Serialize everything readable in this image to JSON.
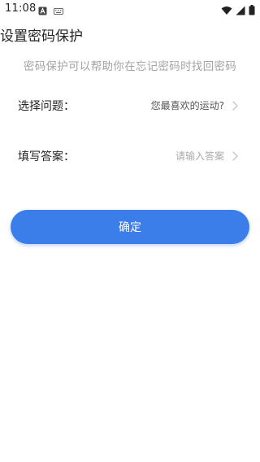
{
  "status_bar": {
    "time": "11:08"
  },
  "page": {
    "title": "设置密码保护",
    "description": "密码保护可以帮助你在忘记密码时找回密码"
  },
  "question_row": {
    "label": "选择问题：",
    "value": "您最喜欢的运动?"
  },
  "answer_row": {
    "label": "填写答案：",
    "placeholder": "请输入答案"
  },
  "confirm_button": {
    "label": "确定"
  },
  "colors": {
    "accent": "#3b7eea",
    "description_text": "#a3a3a3",
    "placeholder_text": "#aaaaaa"
  },
  "icons": {
    "status_left": [
      "notification-a-icon",
      "keyboard-icon"
    ],
    "status_right": [
      "wifi-icon",
      "signal-icon",
      "battery-icon"
    ],
    "row_chevron": "chevron-right-icon"
  }
}
